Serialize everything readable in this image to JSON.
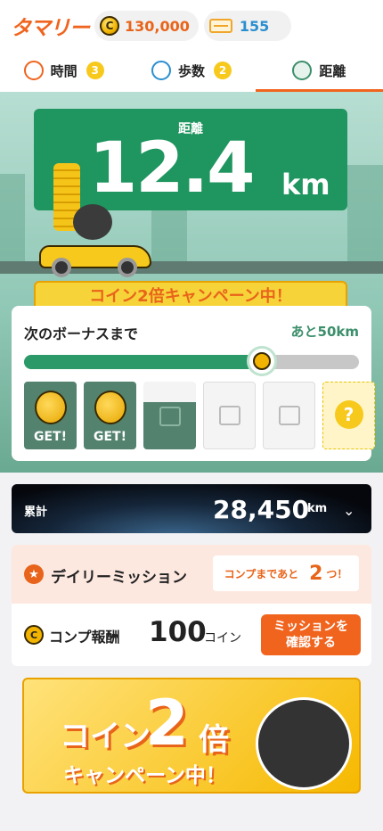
{
  "header": {
    "logo": "タマリー",
    "coin_symbol": "C",
    "coins": "130,000",
    "tickets": "155"
  },
  "tabs": [
    {
      "label": "時間",
      "badge": "3"
    },
    {
      "label": "歩数",
      "badge": "2"
    },
    {
      "label": "距離",
      "badge": ""
    }
  ],
  "distance": {
    "label": "距離",
    "value": "12.4",
    "unit": "km"
  },
  "campaign_ribbon": "コイン2倍キャンペーン中！",
  "bonus": {
    "title": "次のボーナスまで",
    "remaining": "あと50km",
    "progress": 0.71,
    "slots": [
      {
        "state": "got",
        "label": "GET!"
      },
      {
        "state": "got",
        "label": "GET!"
      },
      {
        "state": "half",
        "label": ""
      },
      {
        "state": "empty",
        "label": ""
      },
      {
        "state": "empty",
        "label": ""
      },
      {
        "state": "mystery",
        "label": "?"
      }
    ]
  },
  "total": {
    "label": "累計",
    "value": "28,450",
    "unit": "km"
  },
  "mission": {
    "title": "デイリーミッション",
    "remaining_prefix": "コンプまであと",
    "remaining_count": "2",
    "remaining_suffix": "つ！",
    "reward_label": "コンプ報酬",
    "reward_value": "100",
    "reward_unit": "コイン",
    "button_line1": "ミッションを",
    "button_line2": "確認する"
  },
  "banner": {
    "line1": "コイン",
    "big": "2",
    "line2": "倍",
    "line3": "キャンペーン中！"
  },
  "colors": {
    "accent": "#f0641e",
    "green": "#1f955f",
    "blue": "#2a8fd0",
    "yellow": "#f7c91c"
  }
}
